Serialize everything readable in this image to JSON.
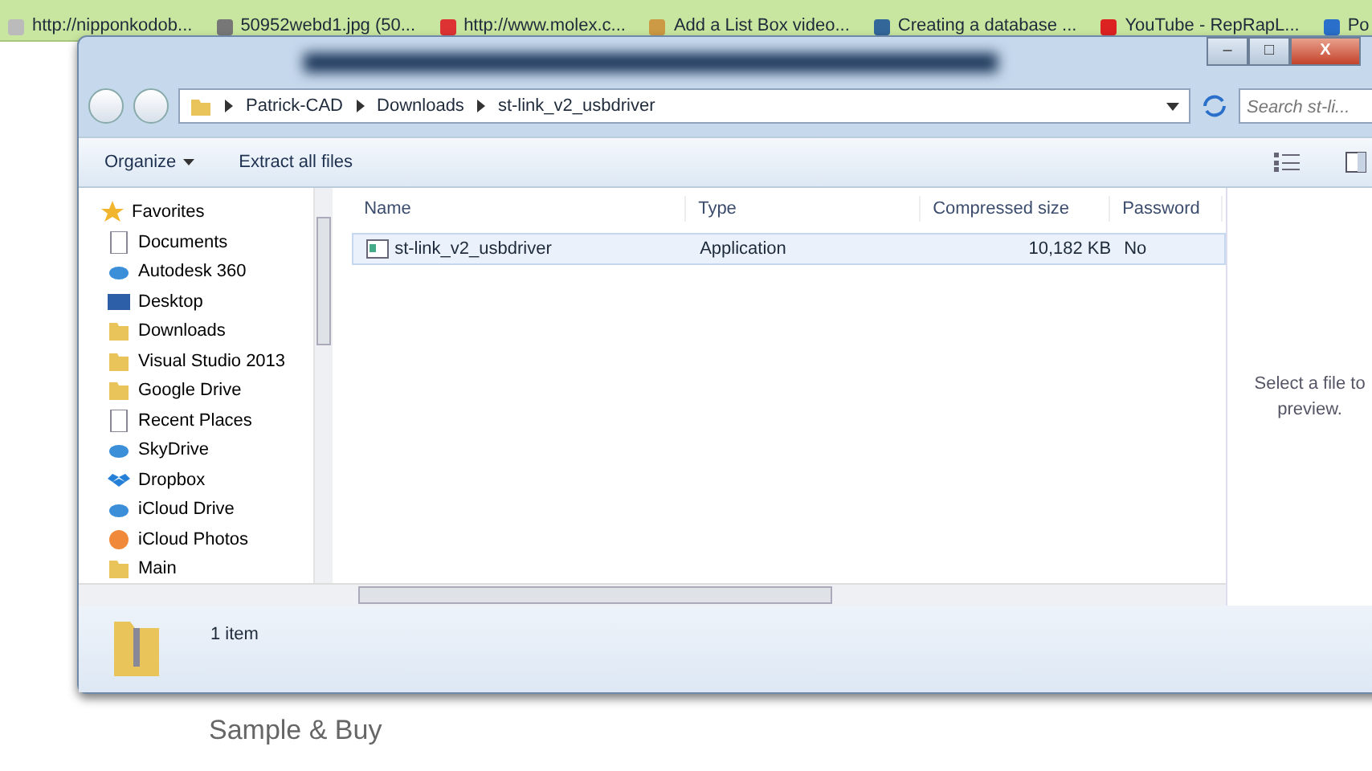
{
  "bookmarks": [
    {
      "label": "http://nipponkodob..."
    },
    {
      "label": "50952webd1.jpg (50..."
    },
    {
      "label": "http://www.molex.c..."
    },
    {
      "label": "Add a List Box video..."
    },
    {
      "label": "Creating a database ..."
    },
    {
      "label": "YouTube - RepRapL..."
    },
    {
      "label": "Po"
    }
  ],
  "window": {
    "controls": [
      "–",
      "□",
      "X"
    ]
  },
  "address": {
    "path": [
      "Patrick-CAD",
      "Downloads",
      "st-link_v2_usbdriver"
    ],
    "search_placeholder": "Search st-li..."
  },
  "toolbar": {
    "buttons": [
      "Organize",
      "Extract all files"
    ]
  },
  "sidebar": {
    "items": [
      {
        "label": "Favorites",
        "kind": "star"
      },
      {
        "label": "Documents",
        "kind": "doc"
      },
      {
        "label": "Autodesk 360",
        "kind": "cloud"
      },
      {
        "label": "Desktop",
        "kind": "desktop"
      },
      {
        "label": "Downloads",
        "kind": "folder"
      },
      {
        "label": "Visual Studio 2013",
        "kind": "folder"
      },
      {
        "label": "Google Drive",
        "kind": "folder"
      },
      {
        "label": "Recent Places",
        "kind": "doc"
      },
      {
        "label": "SkyDrive",
        "kind": "cloud"
      },
      {
        "label": "Dropbox",
        "kind": "dropbox"
      },
      {
        "label": "iCloud Drive",
        "kind": "cloud"
      },
      {
        "label": "iCloud Photos",
        "kind": "photos"
      },
      {
        "label": "Main",
        "kind": "folder"
      }
    ]
  },
  "table": {
    "columns": [
      "Name",
      "Type",
      "Compressed size",
      "Password"
    ],
    "rows": [
      {
        "cells": [
          "st-link_v2_usbdriver",
          "Application",
          "10,182 KB",
          "No"
        ],
        "selected": true
      }
    ]
  },
  "preview": {
    "text": "Select a file to preview."
  },
  "status_bar": {
    "count": "1 item"
  },
  "caption": "Sample & Buy"
}
